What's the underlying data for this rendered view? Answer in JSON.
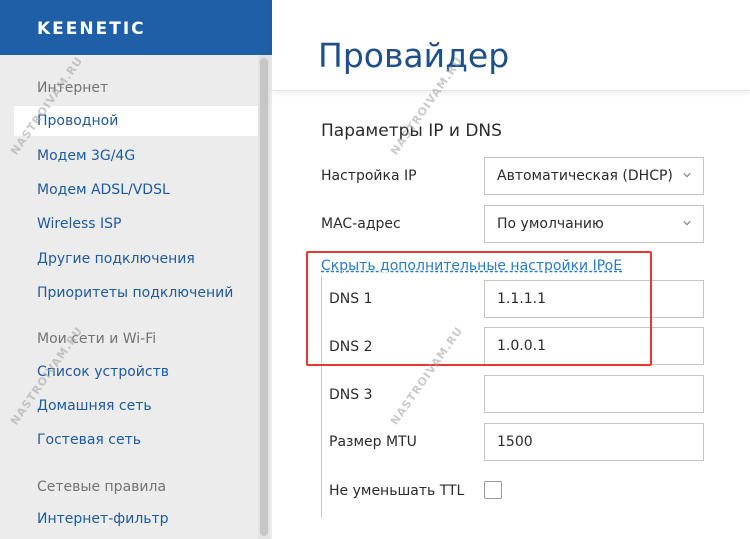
{
  "brand": {
    "logo_text": "KEENETIC"
  },
  "sidebar": {
    "groups": [
      {
        "label": "Интернет",
        "items": [
          {
            "label": "Проводной",
            "active": true
          },
          {
            "label": "Модем 3G/4G"
          },
          {
            "label": "Модем ADSL/VDSL"
          },
          {
            "label": "Wireless ISP"
          },
          {
            "label": "Другие подключения"
          },
          {
            "label": "Приоритеты подключений"
          }
        ]
      },
      {
        "label": "Мои сети и Wi-Fi",
        "items": [
          {
            "label": "Список устройств"
          },
          {
            "label": "Домашняя сеть"
          },
          {
            "label": "Гостевая сеть"
          }
        ]
      },
      {
        "label": "Сетевые правила",
        "items": [
          {
            "label": "Интернет-фильтр"
          }
        ]
      }
    ]
  },
  "main": {
    "title": "Провайдер",
    "section_title": "Параметры IP и DNS",
    "ip_setting": {
      "label": "Настройка IP",
      "value": "Автоматическая (DHCP)"
    },
    "mac_address": {
      "label": "MAC-адрес",
      "value": "По умолчанию"
    },
    "toggle_link": "Скрыть дополнительные настройки IPoE",
    "dns1": {
      "label": "DNS 1",
      "value": "1.1.1.1"
    },
    "dns2": {
      "label": "DNS 2",
      "value": "1.0.0.1"
    },
    "dns3": {
      "label": "DNS 3",
      "value": ""
    },
    "mtu": {
      "label": "Размер MTU",
      "value": "1500"
    },
    "ttl": {
      "label": "Не уменьшать TTL",
      "checked": false
    }
  },
  "watermark": {
    "text": "NASTROIVAM.RU"
  },
  "colors": {
    "brand_blue": "#1f5fa8",
    "link_blue": "#2a7ac4",
    "highlight_red": "#e53935",
    "sidebar_bg": "#ececec"
  }
}
